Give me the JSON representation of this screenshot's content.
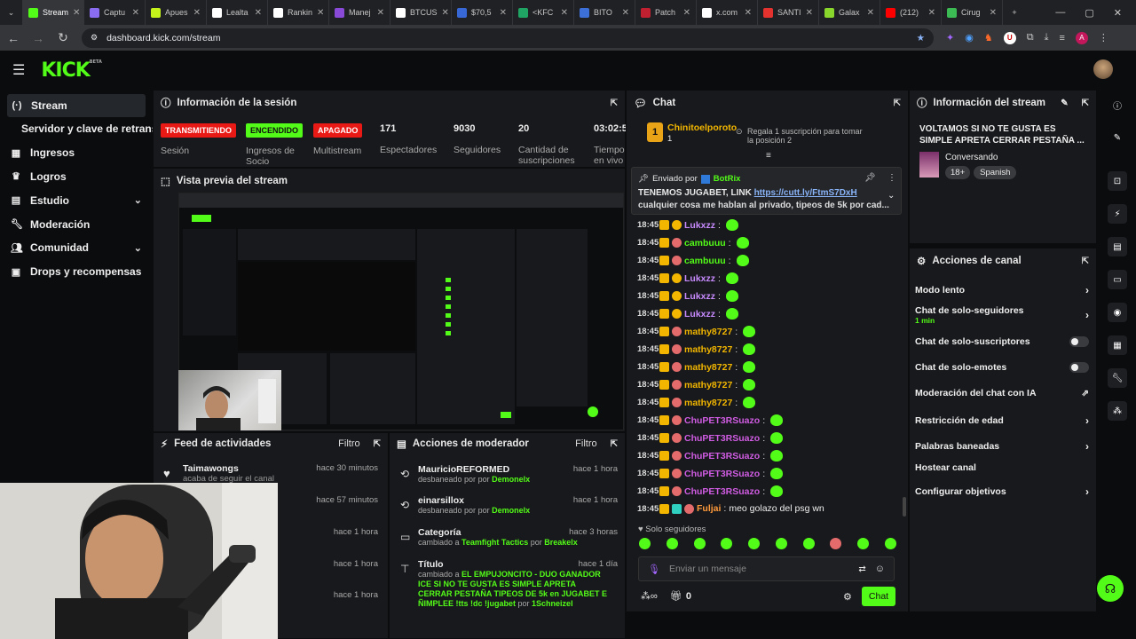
{
  "browser": {
    "tabs": [
      {
        "label": "Stream",
        "color": "#53fc18"
      },
      {
        "label": "Captu",
        "color": "#8a6cf0"
      },
      {
        "label": "Apues",
        "color": "#c6f21b"
      },
      {
        "label": "Lealta",
        "color": "#ffffff"
      },
      {
        "label": "Rankin",
        "color": "#ffffff"
      },
      {
        "label": "Manej",
        "color": "#8a4ad8"
      },
      {
        "label": "BTCUS",
        "color": "#ffffff"
      },
      {
        "label": "$70,5",
        "color": "#3867d6"
      },
      {
        "label": "<KFC",
        "color": "#1fa463"
      },
      {
        "label": "BITO",
        "color": "#3d6fd8"
      },
      {
        "label": "Patch",
        "color": "#c02030"
      },
      {
        "label": "x.com",
        "color": "#ffffff"
      },
      {
        "label": "SANTI",
        "color": "#e4332e"
      },
      {
        "label": "Galax",
        "color": "#89d62c"
      },
      {
        "label": "(212)",
        "color": "#ff0000"
      },
      {
        "label": "Cirug",
        "color": "#3cba54"
      }
    ],
    "url": "dashboard.kick.com/stream",
    "profile_initial": "A"
  },
  "app": {
    "logo": "KICK",
    "logo_sup": "BETA"
  },
  "sidebar": {
    "items": [
      {
        "label": "Stream",
        "icon": "stream-icon"
      },
      {
        "label": "Servidor y clave de retransm"
      },
      {
        "label": "Ingresos",
        "icon": "chart-icon"
      },
      {
        "label": "Logros",
        "icon": "trophy-icon"
      },
      {
        "label": "Estudio",
        "icon": "studio-icon"
      },
      {
        "label": "Moderación",
        "icon": "wrench-icon"
      },
      {
        "label": "Comunidad",
        "icon": "community-icon"
      },
      {
        "label": "Drops y recompensas",
        "icon": "drops-icon"
      }
    ]
  },
  "session": {
    "title": "Información de la sesión",
    "badges": [
      {
        "label": "TRANSMITIENDO",
        "caption": "Sesión"
      },
      {
        "label": "ENCENDIDO",
        "caption": "Ingresos de Socio"
      },
      {
        "label": "APAGADO",
        "caption": "Multistream"
      }
    ],
    "stats": [
      {
        "value": "171",
        "label": "Espectadores"
      },
      {
        "value": "9030",
        "label": "Seguidores"
      },
      {
        "value": "20",
        "label": "Cantidad de suscripciones"
      },
      {
        "value": "03:02:5",
        "label": "Tiempo en vivo"
      }
    ]
  },
  "preview": {
    "title": "Vista previa del stream"
  },
  "feed": {
    "title": "Feed de actividades",
    "filter": "Filtro",
    "rows": [
      {
        "name": "Taimawongs",
        "sub": "acaba de seguir el canal",
        "time": "hace 30 minutos"
      },
      {
        "name": "",
        "sub": "",
        "time": "hace 57 minutos"
      },
      {
        "name": "",
        "sub": "",
        "time": "hace 1 hora"
      },
      {
        "name": "",
        "sub": "",
        "time": "hace 1 hora"
      },
      {
        "name": "",
        "sub": "",
        "time": "hace 1 hora"
      }
    ]
  },
  "mod": {
    "title": "Acciones de moderador",
    "filter": "Filtro",
    "rows": [
      {
        "name": "MauricioREFORMED",
        "action": "desbaneado por",
        "by": "Demonelx",
        "time": "hace 1 hora"
      },
      {
        "name": "einarsillox",
        "action": "desbaneado por",
        "by": "Demonelx",
        "time": "hace 1 hora"
      },
      {
        "name": "Categoría",
        "action": "cambiado a",
        "value": "Teamfight Tactics",
        "by_word": "por",
        "by": "Breakelx",
        "time": "hace 3 horas"
      },
      {
        "name": "Título",
        "action": "cambiado a",
        "value": "EL EMPUJONCITO - DUO GANADOR ICE SI NO TE GUSTA ES SIMPLE APRETA CERRAR PESTAÑA TIPEOS DE 5k en JUGABET E ÑIMPLEE !tts !dc !jugabet",
        "by_word": "por",
        "by": "1Schneizel",
        "time": "hace 1 día"
      }
    ]
  },
  "chat": {
    "title": "Chat",
    "gift": {
      "user": "Chinitoelporoto",
      "count": "1",
      "text": "Regala 1 suscripción para tomar la posición 2"
    },
    "pinned": {
      "by_label": "Enviado por",
      "by": "BotRix",
      "line1": "TENEMOS JUGABET, LINK",
      "link": "https://cutt.ly/FtmS7DxH",
      "line2": "cualquier cosa me hablan al privado, tipeos de 5k por cad..."
    },
    "messages": [
      {
        "time": "18:45",
        "user": "Lukxzz",
        "color": "#c78bff",
        "text": ""
      },
      {
        "time": "18:45",
        "user": "cambuuu",
        "color": "#53fc18",
        "text": ""
      },
      {
        "time": "18:45",
        "user": "cambuuu",
        "color": "#53fc18",
        "text": ""
      },
      {
        "time": "18:45",
        "user": "Lukxzz",
        "color": "#c78bff",
        "text": ""
      },
      {
        "time": "18:45",
        "user": "Lukxzz",
        "color": "#c78bff",
        "text": ""
      },
      {
        "time": "18:45",
        "user": "Lukxzz",
        "color": "#c78bff",
        "text": ""
      },
      {
        "time": "18:45",
        "user": "mathy8727",
        "color": "#f2b600",
        "text": ""
      },
      {
        "time": "18:45",
        "user": "mathy8727",
        "color": "#f2b600",
        "text": ""
      },
      {
        "time": "18:45",
        "user": "mathy8727",
        "color": "#f2b600",
        "text": ""
      },
      {
        "time": "18:45",
        "user": "mathy8727",
        "color": "#f2b600",
        "text": ""
      },
      {
        "time": "18:45",
        "user": "mathy8727",
        "color": "#f2b600",
        "text": ""
      },
      {
        "time": "18:45",
        "user": "ChuPET3RSuazo",
        "color": "#d05ce3",
        "text": ""
      },
      {
        "time": "18:45",
        "user": "ChuPET3RSuazo",
        "color": "#d05ce3",
        "text": ""
      },
      {
        "time": "18:45",
        "user": "ChuPET3RSuazo",
        "color": "#d05ce3",
        "text": ""
      },
      {
        "time": "18:45",
        "user": "ChuPET3RSuazo",
        "color": "#d05ce3",
        "text": ""
      },
      {
        "time": "18:45",
        "user": "ChuPET3RSuazo",
        "color": "#d05ce3",
        "text": ""
      },
      {
        "time": "18:45",
        "user": "Fuljai",
        "color": "#ff9a3c",
        "text": "meo golazo del psg wn"
      }
    ],
    "followers_only": "Solo seguidores",
    "placeholder": "Enviar un mensaje",
    "points": "0",
    "send_label": "Chat"
  },
  "stream_info": {
    "title": "Información del stream",
    "stream_title": "VOLTAMOS SI NO TE GUSTA ES SIMPLE APRETA CERRAR PESTAÑA ...",
    "category": "Conversando",
    "tags": [
      "18+",
      "Spanish"
    ]
  },
  "channel_actions": {
    "title": "Acciones de canal",
    "items": [
      {
        "label": "Modo lento",
        "kind": "chevron"
      },
      {
        "label": "Chat de solo-seguidores",
        "sub": "1 min",
        "kind": "chevron"
      },
      {
        "label": "Chat de solo-suscriptores",
        "kind": "toggle"
      },
      {
        "label": "Chat de solo-emotes",
        "kind": "toggle"
      },
      {
        "label": "Moderación del chat con IA",
        "kind": "link"
      },
      {
        "label": "Restricción de edad",
        "kind": "chevron"
      },
      {
        "label": "Palabras baneadas",
        "kind": "chevron"
      },
      {
        "label": "Hostear canal",
        "kind": "none"
      },
      {
        "label": "Configurar objetivos",
        "kind": "chevron"
      }
    ]
  },
  "colors": {
    "accent": "#53fc18",
    "live_red": "#e91916",
    "panel": "#18191c"
  }
}
